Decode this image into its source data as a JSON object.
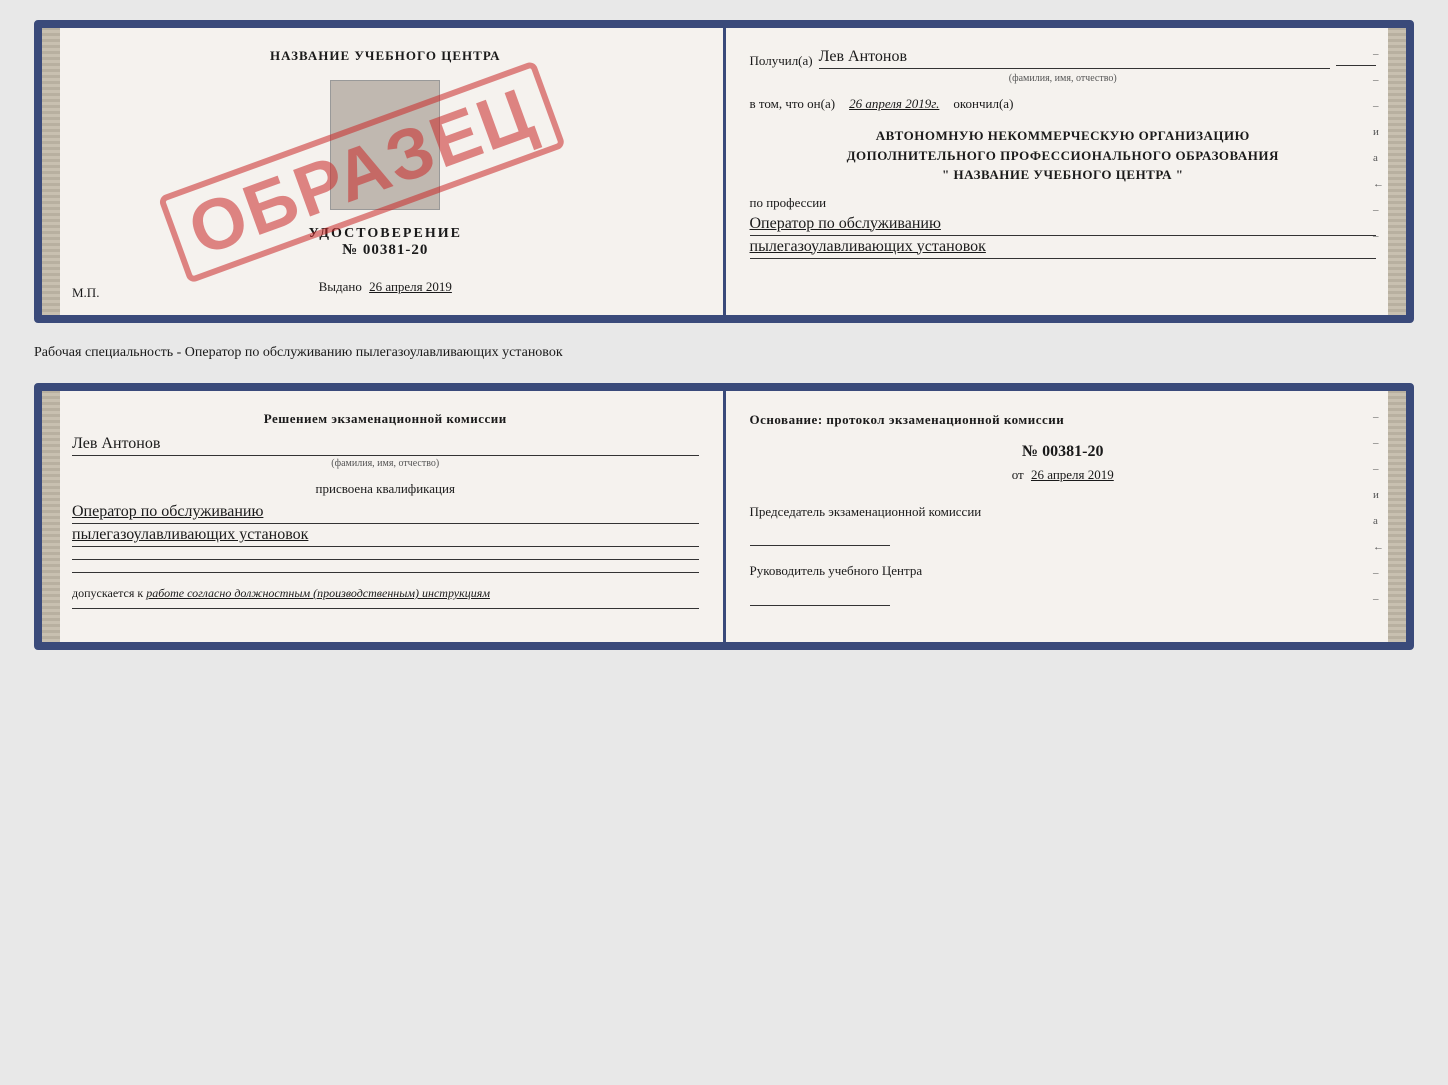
{
  "top_doc": {
    "left": {
      "title": "НАЗВАНИЕ УЧЕБНОГО ЦЕНТРА",
      "certificate_label": "УДОСТОВЕРЕНИЕ",
      "certificate_number": "№ 00381-20",
      "vydano_label": "Выдано",
      "vydano_date": "26 апреля 2019",
      "mp_label": "М.П.",
      "stamp_text": "ОБРАЗЕЦ"
    },
    "right": {
      "poluchil_label": "Получил(а)",
      "poluchil_name": "Лев Антонов",
      "fio_hint": "(фамилия, имя, отчество)",
      "vtom_label": "в том, что он(а)",
      "vtom_date": "26 апреля 2019г.",
      "okonchil_label": "окончил(а)",
      "org_line1": "АВТОНОМНУЮ НЕКОММЕРЧЕСКУЮ ОРГАНИЗАЦИЮ",
      "org_line2": "ДОПОЛНИТЕЛЬНОГО ПРОФЕССИОНАЛЬНОГО ОБРАЗОВАНИЯ",
      "org_name_quotes": "\" НАЗВАНИЕ УЧЕБНОГО ЦЕНТРА \"",
      "po_professii": "по профессии",
      "professiya_line1": "Оператор по обслуживанию",
      "professiya_line2": "пылегазоулавливающих установок"
    }
  },
  "middle_label": "Рабочая специальность - Оператор по обслуживанию пылегазоулавливающих установок",
  "bottom_doc": {
    "left": {
      "resheniye_title": "Решением экзаменационной комиссии",
      "komissia_name": "Лев Антонов",
      "fio_hint": "(фамилия, имя, отчество)",
      "prisvoena_label": "присвоена квалификация",
      "kvalif_line1": "Оператор по обслуживанию",
      "kvalif_line2": "пылегазоулавливающих установок",
      "dopuskaetsya_label": "допускается к",
      "dopuskaetsya_text": "работе согласно должностным (производственным) инструкциям"
    },
    "right": {
      "osnovanie_label": "Основание: протокол экзаменационной комиссии",
      "protocol_number": "№ 00381-20",
      "ot_label": "от",
      "protocol_date": "26 апреля 2019",
      "predsedatel_label": "Председатель экзаменационной комиссии",
      "rukovoditel_label": "Руководитель учебного Центра"
    }
  },
  "vertical_marks": [
    "-",
    "-",
    "-",
    "и",
    "а",
    "←",
    "-",
    "-"
  ]
}
